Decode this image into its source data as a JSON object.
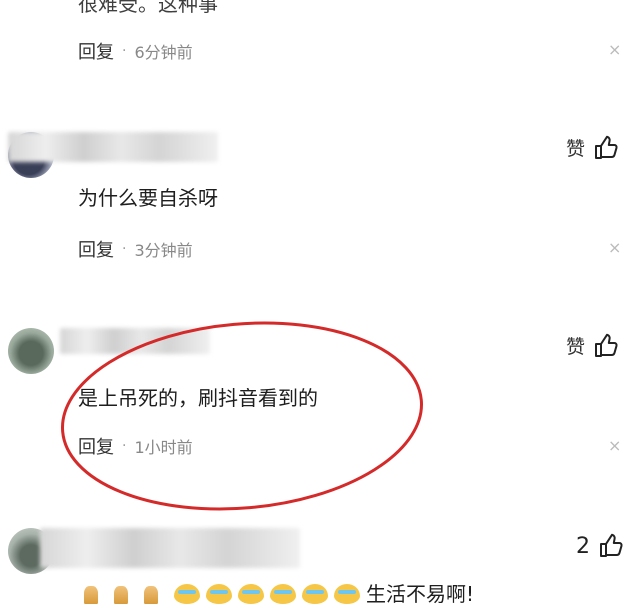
{
  "top_comment": {
    "partial_text": "很难受。这种事",
    "reply_label": "回复",
    "separator": "·",
    "time": "6分钟前",
    "close_glyph": "×"
  },
  "comments": [
    {
      "text": "为什么要自杀呀",
      "like_label": "赞",
      "reply_label": "回复",
      "separator": "·",
      "time": "3分钟前",
      "close_glyph": "×"
    },
    {
      "text": "是上吊死的，刷抖音看到的",
      "like_label": "赞",
      "reply_label": "回复",
      "separator": "·",
      "time": "1小时前",
      "close_glyph": "×",
      "highlighted": true,
      "highlight_color": "#d42a2a"
    },
    {
      "like_count": "2",
      "text_tail": "生活不易啊!"
    }
  ],
  "icons": {
    "thumbs_up": "thumbs-up-icon",
    "close": "close-icon",
    "avatar": "avatar"
  }
}
